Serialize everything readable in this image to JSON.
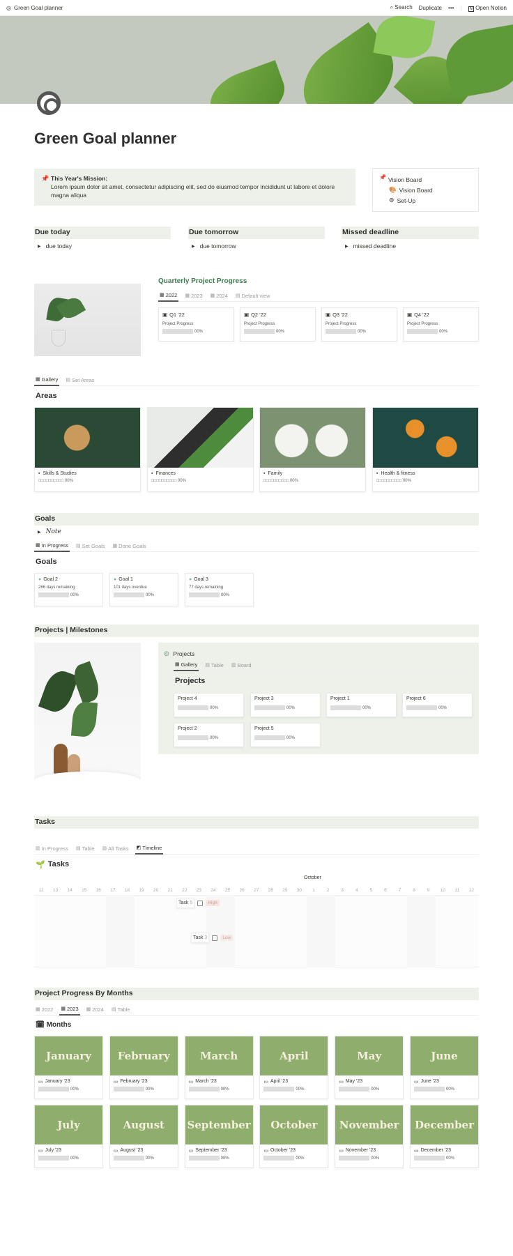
{
  "topbar": {
    "title": "Green Goal planner",
    "search": "Search",
    "duplicate": "Duplicate",
    "more": "•••",
    "open": "Open Notion"
  },
  "page": {
    "title": "Green Goal planner",
    "icon": "target-icon"
  },
  "mission": {
    "heading": "This Year's Mission:",
    "text": "Lorem ipsum dolor sit amet, consectetur adipiscing elit, sed do eiusmod tempor incididunt ut labore et dolore magna aliqua"
  },
  "vision": {
    "heading": "Vision Board",
    "links": [
      "Vision Board",
      "Set-Up"
    ]
  },
  "due": [
    {
      "title": "Due today",
      "item": "due today"
    },
    {
      "title": "Due tomorrow",
      "item": "due tomorrow"
    },
    {
      "title": "Missed deadline",
      "item": "missed deadline"
    }
  ],
  "quarterly": {
    "title": "Quarterly Project Progress",
    "title_color": "#3f7a4e",
    "tabs": [
      "2022",
      "2023",
      "2024",
      "Default view"
    ],
    "active": 0,
    "cards": [
      {
        "name": "Q1 '22",
        "label": "Project Progress",
        "pct": "00%"
      },
      {
        "name": "Q2 '22",
        "label": "Project Progress",
        "pct": "00%"
      },
      {
        "name": "Q3 '22",
        "label": "Project Progress",
        "pct": "00%"
      },
      {
        "name": "Q4 '22",
        "label": "Project Progress",
        "pct": "00%"
      }
    ]
  },
  "areas": {
    "tabs": [
      "Gallery",
      "Set Areas"
    ],
    "heading": "Areas",
    "cards": [
      {
        "name": "Skills & Studies",
        "progress": "□□□□□□□□□□ 00%"
      },
      {
        "name": "Finances",
        "progress": "□□□□□□□□□□ 00%"
      },
      {
        "name": "Family",
        "progress": "□□□□□□□□□□ 00%"
      },
      {
        "name": "Health & fitness",
        "progress": "□□□□□□□□□□ 00%"
      }
    ]
  },
  "goals": {
    "header": "Goals",
    "note": "Note",
    "tabs": [
      "In Progress",
      "Set Goals",
      "Done Goals"
    ],
    "heading": "Goals",
    "cards": [
      {
        "name": "Goal 2",
        "status": "266 days remaining",
        "pct": "00%"
      },
      {
        "name": "Goal 1",
        "status": "101 days overdue",
        "pct": "00%"
      },
      {
        "name": "Goal 3",
        "status": "77 days remaining",
        "pct": "00%"
      }
    ]
  },
  "projects": {
    "header": "Projects | Milestones",
    "db_title": "Projects",
    "tabs": [
      "Gallery",
      "Table",
      "Board"
    ],
    "heading": "Projects",
    "cards": [
      {
        "name": "Project 4",
        "pct": "00%"
      },
      {
        "name": "Project 3",
        "pct": "00%"
      },
      {
        "name": "Project 1",
        "pct": "00%"
      },
      {
        "name": "Project 6",
        "pct": "00%"
      },
      {
        "name": "Project 2",
        "pct": "00%"
      },
      {
        "name": "Project 5",
        "pct": "00%"
      }
    ]
  },
  "tasks": {
    "header": "Tasks",
    "tabs": [
      "In Progress",
      "Table",
      "All Tasks",
      "Timeline"
    ],
    "heading": "Tasks",
    "month": "October",
    "days": [
      "12",
      "13",
      "14",
      "15",
      "16",
      "17",
      "18",
      "19",
      "20",
      "21",
      "22",
      "23",
      "24",
      "25",
      "26",
      "27",
      "28",
      "29",
      "30",
      "1",
      "2",
      "3",
      "4",
      "5",
      "6",
      "7",
      "8",
      "9",
      "10",
      "11",
      "12"
    ],
    "items": [
      {
        "name": "Task",
        "num": "5",
        "priority": "High",
        "priority_color": "#f6e4e0"
      },
      {
        "name": "Task",
        "num": "3",
        "priority": "Low",
        "priority_color": "#f6e9e6"
      }
    ]
  },
  "months": {
    "header": "Project Progress By Months",
    "tabs": [
      "2022",
      "2023",
      "2024",
      "Table"
    ],
    "heading": "Months",
    "card_color": "#8fae6e",
    "cards": [
      {
        "name": "January",
        "label": "January '23",
        "pct": "00%"
      },
      {
        "name": "February",
        "label": "February '23",
        "pct": "00%"
      },
      {
        "name": "March",
        "label": "March '23",
        "pct": "00%"
      },
      {
        "name": "April",
        "label": "April '23",
        "pct": "00%"
      },
      {
        "name": "May",
        "label": "May '23",
        "pct": "00%"
      },
      {
        "name": "June",
        "label": "June '23",
        "pct": "00%"
      },
      {
        "name": "July",
        "label": "July '23",
        "pct": "00%"
      },
      {
        "name": "August",
        "label": "August '23",
        "pct": "00%"
      },
      {
        "name": "September",
        "label": "September '23",
        "pct": "00%"
      },
      {
        "name": "October",
        "label": "October '23",
        "pct": "00%"
      },
      {
        "name": "November",
        "label": "November '23",
        "pct": "00%"
      },
      {
        "name": "December",
        "label": "December '23",
        "pct": "00%"
      }
    ]
  }
}
